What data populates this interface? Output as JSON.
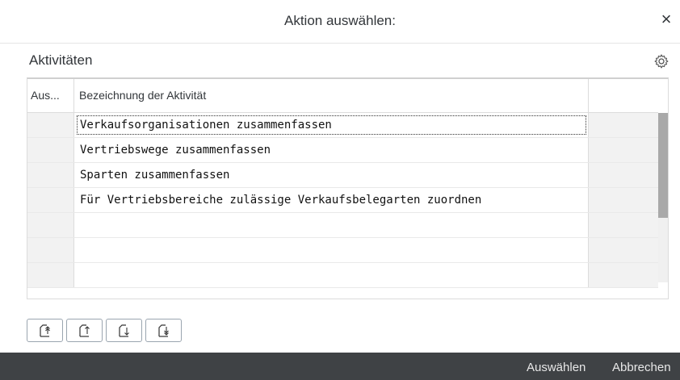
{
  "dialog": {
    "title": "Aktion auswählen:",
    "close_label": "×"
  },
  "section": {
    "title": "Aktivitäten",
    "settings_icon": "gear-icon"
  },
  "table": {
    "columns": [
      "Aus...",
      "Bezeichnung der Aktivität",
      ""
    ],
    "rows": [
      "Verkaufsorganisationen zusammenfassen",
      "Vertriebswege zusammenfassen",
      "Sparten zusammenfassen",
      "Für Vertriebsbereiche zulässige Verkaufsbelegarten zuordnen",
      "",
      "",
      ""
    ],
    "focused_row": 0
  },
  "toolbar": {
    "buttons": [
      "move-first-icon",
      "move-up-icon",
      "move-down-icon",
      "move-last-icon"
    ]
  },
  "footer": {
    "select_label": "Auswählen",
    "cancel_label": "Abbrechen"
  },
  "colors": {
    "footer_bg": "#3f4245",
    "scroll_thumb": "#a9a9a9",
    "selection_column": "#f2f2f2"
  }
}
